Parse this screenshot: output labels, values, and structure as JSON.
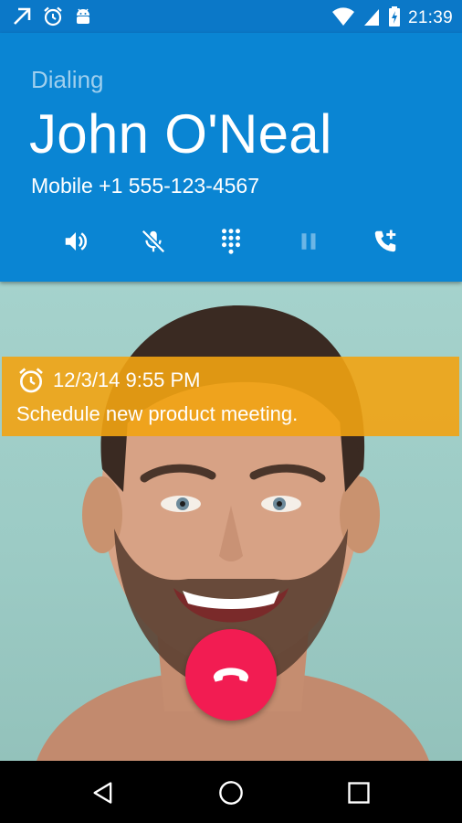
{
  "status_bar": {
    "time": "21:39",
    "icons_left": [
      "arrow-up-right-icon",
      "alarm-icon",
      "android-icon"
    ],
    "icons_right": [
      "wifi-icon",
      "cell-signal-icon",
      "battery-charging-icon"
    ]
  },
  "call": {
    "status": "Dialing",
    "caller_name": "John O'Neal",
    "number": "Mobile +1 555-123-4567",
    "controls": [
      "speaker-icon",
      "mute-icon",
      "dialpad-icon",
      "hold-icon",
      "add-call-icon"
    ]
  },
  "reminder": {
    "datetime": "12/3/14 9:55 PM",
    "text": "Schedule new product meeting."
  },
  "colors": {
    "header": "#0a85d3",
    "reminder": "#f2a312",
    "end_call": "#f21c52"
  },
  "nav": [
    "back-icon",
    "home-icon",
    "recents-icon"
  ]
}
